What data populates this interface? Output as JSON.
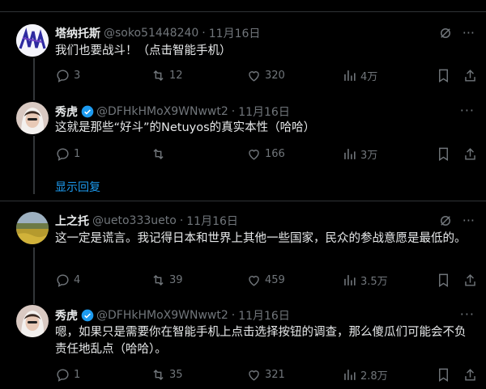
{
  "tweets": [
    {
      "name": "塔纳托斯",
      "handle": "@soko51448240",
      "date": "11月16日",
      "text": "我们也要战斗！（点击智能手机）",
      "replies": "3",
      "retweets": "12",
      "likes": "320",
      "views": "4万",
      "avatar": "abstract-logo"
    },
    {
      "name": "秀虎",
      "handle": "@DFHkHMoX9WNwwt2",
      "date": "11月16日",
      "text": "这就是那些“好斗”的Netuyos的真实本性（哈哈）",
      "replies": "1",
      "retweets": "",
      "likes": "166",
      "views": "3万",
      "avatar": "person-photo"
    },
    {
      "name": "上之托",
      "handle": "@ueto333ueto",
      "date": "11月16日",
      "text": "这一定是谎言。我记得日本和世界上其他一些国家，民众的参战意愿是最低的。",
      "replies": "4",
      "retweets": "39",
      "likes": "459",
      "views": "3.5万",
      "avatar": "field-photo"
    },
    {
      "name": "秀虎",
      "handle": "@DFHkHMoX9WNwwt2",
      "date": "11月16日",
      "text": "嗯，如果只是需要你在智能手机上点击选择按钮的调查，那么傻瓜们可能会不负责任地乱点（哈哈）。",
      "replies": "1",
      "retweets": "35",
      "likes": "321",
      "views": "2.8万",
      "avatar": "person-photo"
    }
  ],
  "show_replies": "显示回复",
  "more_glyph": "···",
  "colors": {
    "accent": "#1d9bf0",
    "muted": "#71767b",
    "text": "#e7e9ea",
    "background": "#000000"
  }
}
